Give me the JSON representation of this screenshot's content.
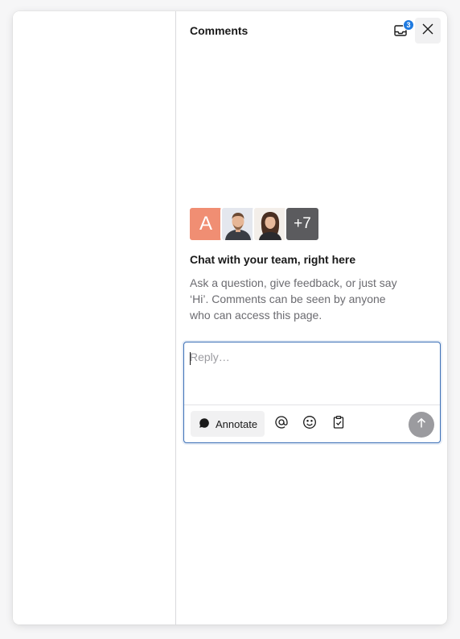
{
  "panel": {
    "title": "Comments",
    "notification_count": "3"
  },
  "participants": {
    "first_initial": "A",
    "more_count": "+7"
  },
  "empty_state": {
    "title": "Chat with your team, right here",
    "description": "Ask a question, give feedback, or just say ‘Hi’. Comments can be seen by anyone who can access this page."
  },
  "composer": {
    "placeholder": "Reply…",
    "annotate_label": "Annotate",
    "tools": [
      "at-mention-icon",
      "emoji-icon",
      "clipboard-check-icon"
    ]
  },
  "colors": {
    "accent": "#1f7ae0",
    "focus_border": "#3b6fb6",
    "avatar_letter_bg": "#f08e73",
    "avatar_more_bg": "#5b5b5e",
    "send_disabled": "#9b9b9f"
  }
}
